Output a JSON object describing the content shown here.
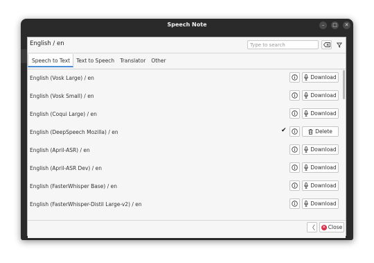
{
  "window": {
    "title": "Speech Note",
    "controls": {
      "minimize": "–",
      "maximize": "□",
      "close": "✕"
    }
  },
  "header": {
    "title": "English / en",
    "search": {
      "placeholder": "Type to search",
      "value": ""
    }
  },
  "tabs": [
    {
      "label": "Speech to Text",
      "active": true
    },
    {
      "label": "Text to Speech",
      "active": false
    },
    {
      "label": "Translator",
      "active": false
    },
    {
      "label": "Other",
      "active": false
    }
  ],
  "models": [
    {
      "name": "English (Vosk Large) / en",
      "action": "Download",
      "installed": false
    },
    {
      "name": "English (Vosk Small) / en",
      "action": "Download",
      "installed": false
    },
    {
      "name": "English (Coqui Large) / en",
      "action": "Download",
      "installed": false
    },
    {
      "name": "English (DeepSpeech Mozilla) / en",
      "action": "Delete",
      "installed": true,
      "check": "✔"
    },
    {
      "name": "English (April-ASR) / en",
      "action": "Download",
      "installed": false
    },
    {
      "name": "English (April-ASR Dev) / en",
      "action": "Download",
      "installed": false
    },
    {
      "name": "English (FasterWhisper Base) / en",
      "action": "Download",
      "installed": false
    },
    {
      "name": "English (FasterWhisper-Distil Large-v2) / en",
      "action": "Download",
      "installed": false
    }
  ],
  "footer": {
    "back": "〈",
    "close_label": "Close"
  },
  "colors": {
    "accent": "#4a8dd6",
    "close": "#d9304a",
    "titlebar": "#2a2a2a"
  }
}
